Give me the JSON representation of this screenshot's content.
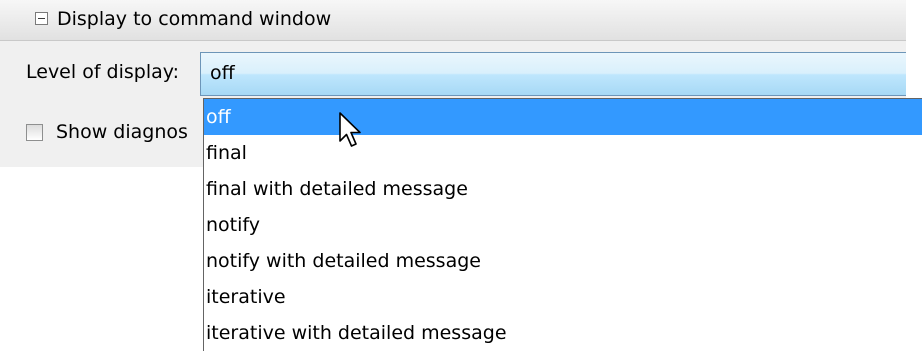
{
  "section": {
    "title": "Display to command window"
  },
  "level": {
    "label": "Level of display:",
    "value": "off"
  },
  "diagnostics": {
    "label": "Show diagnos",
    "checked": false
  },
  "dropdown": {
    "options": [
      "off",
      "final",
      "final with detailed message",
      "notify",
      "notify with detailed message",
      "iterative",
      "iterative with detailed message"
    ],
    "selected_index": 0
  },
  "colors": {
    "selection": "#3399ff",
    "field_border": "#6d95b8"
  },
  "icons": {
    "collapse": "minus-box-icon",
    "pointer": "arrow-cursor-icon"
  }
}
